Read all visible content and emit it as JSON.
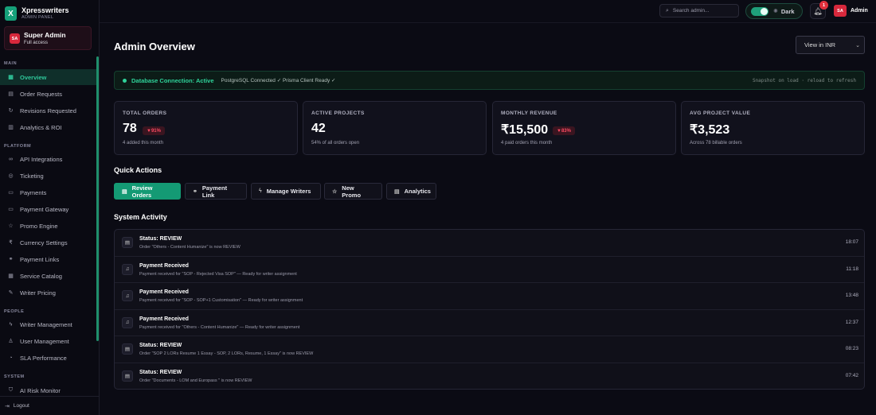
{
  "brand": {
    "logo": "X",
    "name": "Xpresswriters",
    "subtitle": "ADMIN PANEL"
  },
  "user_card": {
    "avatar": "SA",
    "name": "Super Admin",
    "role": "Full access"
  },
  "sidebar": {
    "sections": [
      {
        "label": "MAIN",
        "items": [
          {
            "label": "Overview",
            "icon": "grid-icon",
            "active": true
          },
          {
            "label": "Order Requests",
            "icon": "clipboard-icon"
          },
          {
            "label": "Revisions Requested",
            "icon": "refresh-icon"
          },
          {
            "label": "Analytics & ROI",
            "icon": "chart-icon"
          }
        ]
      },
      {
        "label": "PLATFORM",
        "items": [
          {
            "label": "API Integrations",
            "icon": "link-icon"
          },
          {
            "label": "Ticketing",
            "icon": "ticket-icon"
          },
          {
            "label": "Payments",
            "icon": "card-icon"
          },
          {
            "label": "Payment Gateway",
            "icon": "gateway-icon"
          },
          {
            "label": "Promo Engine",
            "icon": "star-icon"
          },
          {
            "label": "Currency Settings",
            "icon": "rupee-icon"
          },
          {
            "label": "Payment Links",
            "icon": "link-icon"
          },
          {
            "label": "Service Catalog",
            "icon": "catalog-icon"
          },
          {
            "label": "Writer Pricing",
            "icon": "tag-icon"
          }
        ]
      },
      {
        "label": "PEOPLE",
        "items": [
          {
            "label": "Writer Management",
            "icon": "lightning-icon"
          },
          {
            "label": "User Management",
            "icon": "user-icon"
          },
          {
            "label": "SLA Performance",
            "icon": "gauge-icon"
          }
        ]
      },
      {
        "label": "SYSTEM",
        "items": [
          {
            "label": "AI Risk Monitor",
            "icon": "shield-icon"
          }
        ]
      }
    ],
    "logout": "Logout"
  },
  "topbar": {
    "search_placeholder": "Search admin...",
    "theme_label": "Dark",
    "notification_count": "1",
    "admin_avatar": "SA",
    "admin_label": "Admin"
  },
  "main": {
    "title": "Admin Overview",
    "currency_select": "View in INR",
    "db_banner": {
      "status": "Database Connection: Active",
      "detail": "PostgreSQL Connected ✓ Prisma Client Ready ✓",
      "note": "Snapshot on load · reload to refresh"
    },
    "stats": [
      {
        "label": "TOTAL ORDERS",
        "value": "78",
        "badge": "▼91%",
        "sub": "4 added this month"
      },
      {
        "label": "ACTIVE PROJECTS",
        "value": "42",
        "badge": "",
        "sub": "54% of all orders open"
      },
      {
        "label": "MONTHLY REVENUE",
        "value": "₹15,500",
        "badge": "▼83%",
        "sub": "4 paid orders this month"
      },
      {
        "label": "AVG PROJECT VALUE",
        "value": "₹3,523",
        "badge": "",
        "sub": "Across 78 billable orders"
      }
    ],
    "quick_actions_title": "Quick Actions",
    "quick_actions": [
      {
        "label": "Review Orders",
        "icon": "document-icon",
        "primary": true
      },
      {
        "label": "Payment Link",
        "icon": "link-icon"
      },
      {
        "label": "Manage Writers",
        "icon": "lightning-icon"
      },
      {
        "label": "New Promo",
        "icon": "star-icon"
      },
      {
        "label": "Analytics",
        "icon": "document-icon"
      }
    ],
    "activity_title": "System Activity",
    "activity": [
      {
        "title": "Status: REVIEW",
        "desc": "Order \"Others - Content Humanize\" is now REVIEW",
        "time": "18:07",
        "icon": "document-icon"
      },
      {
        "title": "Payment Received",
        "desc": "Payment received for \"SOP - Rejected Visa SOP\" — Ready for writer assignment",
        "time": "11:18",
        "icon": "bell-icon"
      },
      {
        "title": "Payment Received",
        "desc": "Payment received for \"SOP - SOP+1 Customisation\" — Ready for writer assignment",
        "time": "13:48",
        "icon": "bell-icon"
      },
      {
        "title": "Payment Received",
        "desc": "Payment received for \"Others - Content Humanize\" — Ready for writer assignment",
        "time": "12:37",
        "icon": "bell-icon"
      },
      {
        "title": "Status: REVIEW",
        "desc": "Order \"SOP 2 LORs Resume 1 Essay - SOP, 2 LORs, Resume, 1 Essay\" is now REVIEW",
        "time": "08:23",
        "icon": "document-icon"
      },
      {
        "title": "Status: REVIEW",
        "desc": "Order \"Documents - LOM and Europass \" is now REVIEW",
        "time": "07:42",
        "icon": "document-icon"
      }
    ]
  },
  "colors": {
    "accent": "#149a74",
    "danger": "#ff4a62",
    "background": "#0b0b14"
  }
}
